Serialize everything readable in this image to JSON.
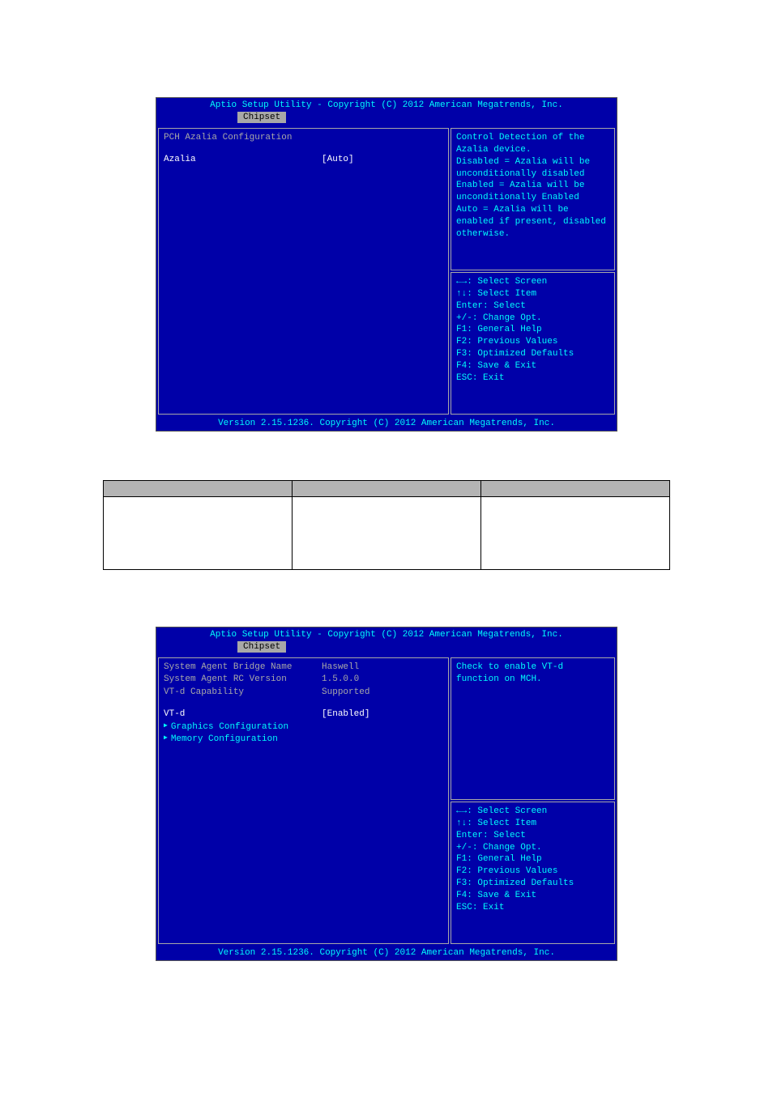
{
  "bios1": {
    "header": "Aptio Setup Utility - Copyright (C) 2012 American Megatrends, Inc.",
    "tab": "Chipset",
    "left": {
      "section_title": "PCH Azalia Configuration",
      "items": [
        {
          "label": "Azalia",
          "value": "[Auto]"
        }
      ]
    },
    "help": "Control Detection of the Azalia device.\nDisabled = Azalia will be unconditionally disabled\nEnabled = Azalia will be unconditionally Enabled\nAuto = Azalia will be enabled if present, disabled otherwise.",
    "keys": [
      "←→: Select Screen",
      "↑↓: Select Item",
      "Enter: Select",
      "+/-: Change Opt.",
      "F1: General Help",
      "F2: Previous Values",
      "F3: Optimized Defaults",
      "F4: Save & Exit",
      "ESC: Exit"
    ],
    "footer": "Version 2.15.1236. Copyright (C) 2012 American Megatrends, Inc."
  },
  "doc_table": {
    "headers": [
      "",
      "",
      ""
    ],
    "cells": [
      "",
      "",
      ""
    ]
  },
  "bios2": {
    "header": "Aptio Setup Utility - Copyright (C) 2012 American Megatrends, Inc.",
    "tab": "Chipset",
    "left": {
      "info": [
        {
          "label": "System Agent Bridge Name",
          "value": "Haswell"
        },
        {
          "label": "System Agent RC Version",
          "value": "1.5.0.0"
        },
        {
          "label": "VT-d Capability",
          "value": "Supported"
        }
      ],
      "selected": {
        "label": "VT-d",
        "value": "[Enabled]"
      },
      "submenus": [
        "Graphics Configuration",
        "Memory Configuration"
      ]
    },
    "help": "Check to enable VT-d function on MCH.",
    "keys": [
      "←→: Select Screen",
      "↑↓: Select Item",
      "Enter: Select",
      "+/-: Change Opt.",
      "F1: General Help",
      "F2: Previous Values",
      "F3: Optimized Defaults",
      "F4: Save & Exit",
      "ESC: Exit"
    ],
    "footer": "Version 2.15.1236. Copyright (C) 2012 American Megatrends, Inc."
  }
}
